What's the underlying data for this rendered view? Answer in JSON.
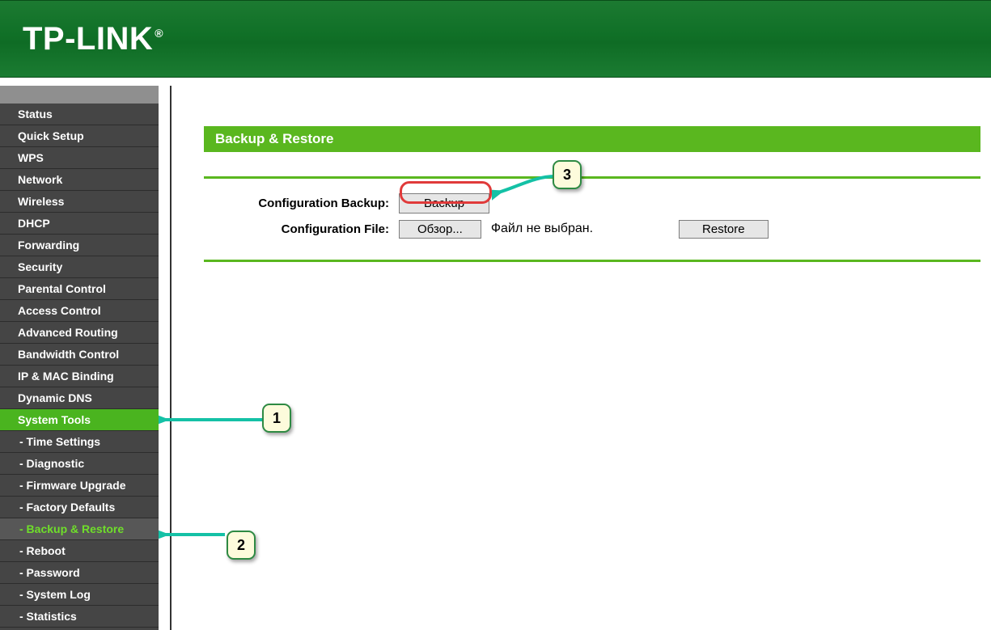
{
  "brand": "TP-LINK",
  "brand_reg": "®",
  "sidebar": [
    {
      "label": "Status",
      "type": "item"
    },
    {
      "label": "Quick Setup",
      "type": "item"
    },
    {
      "label": "WPS",
      "type": "item"
    },
    {
      "label": "Network",
      "type": "item"
    },
    {
      "label": "Wireless",
      "type": "item"
    },
    {
      "label": "DHCP",
      "type": "item"
    },
    {
      "label": "Forwarding",
      "type": "item"
    },
    {
      "label": "Security",
      "type": "item"
    },
    {
      "label": "Parental Control",
      "type": "item"
    },
    {
      "label": "Access Control",
      "type": "item"
    },
    {
      "label": "Advanced Routing",
      "type": "item"
    },
    {
      "label": "Bandwidth Control",
      "type": "item"
    },
    {
      "label": "IP & MAC Binding",
      "type": "item"
    },
    {
      "label": "Dynamic DNS",
      "type": "item"
    },
    {
      "label": "System Tools",
      "type": "parent"
    },
    {
      "label": "- Time Settings",
      "type": "sub"
    },
    {
      "label": "- Diagnostic",
      "type": "sub"
    },
    {
      "label": "- Firmware Upgrade",
      "type": "sub"
    },
    {
      "label": "- Factory Defaults",
      "type": "sub"
    },
    {
      "label": "- Backup & Restore",
      "type": "sub",
      "active": true
    },
    {
      "label": "- Reboot",
      "type": "sub"
    },
    {
      "label": "- Password",
      "type": "sub"
    },
    {
      "label": "- System Log",
      "type": "sub"
    },
    {
      "label": "- Statistics",
      "type": "sub"
    }
  ],
  "page": {
    "title": "Backup & Restore",
    "row1_label": "Configuration Backup:",
    "backup_btn": "Backup",
    "row2_label": "Configuration File:",
    "browse_btn": "Обзор...",
    "file_status": "Файл не выбран.",
    "restore_btn": "Restore"
  },
  "callouts": {
    "c1": "1",
    "c2": "2",
    "c3": "3"
  }
}
